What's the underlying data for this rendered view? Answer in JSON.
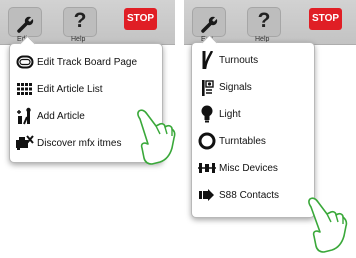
{
  "left": {
    "toolbar": {
      "edit_label": "Edit",
      "help_label": "Help",
      "help_glyph": "?",
      "stop_label": "STOP"
    },
    "menu": {
      "items": [
        {
          "label": "Edit Track Board Page",
          "icon": "track-board-icon"
        },
        {
          "label": "Edit Article List",
          "icon": "article-list-icon"
        },
        {
          "label": "Add Article",
          "icon": "add-article-icon"
        },
        {
          "label": "Discover mfx itmes",
          "icon": "discover-mfx-icon"
        }
      ]
    }
  },
  "right": {
    "toolbar": {
      "edit_label": "Edit",
      "help_label": "Help",
      "help_glyph": "?",
      "stop_label": "STOP"
    },
    "menu": {
      "items": [
        {
          "label": "Turnouts",
          "icon": "turnout-icon"
        },
        {
          "label": "Signals",
          "icon": "signal-icon"
        },
        {
          "label": "Light",
          "icon": "light-bulb-icon"
        },
        {
          "label": "Turntables",
          "icon": "turntable-icon"
        },
        {
          "label": "Misc Devices",
          "icon": "misc-devices-icon"
        },
        {
          "label": "S88 Contacts",
          "icon": "s88-contact-icon"
        }
      ]
    }
  },
  "colors": {
    "stop": "#e01e25",
    "toolbar": "#c8c8c8",
    "hand_outline": "#3aa83a"
  }
}
